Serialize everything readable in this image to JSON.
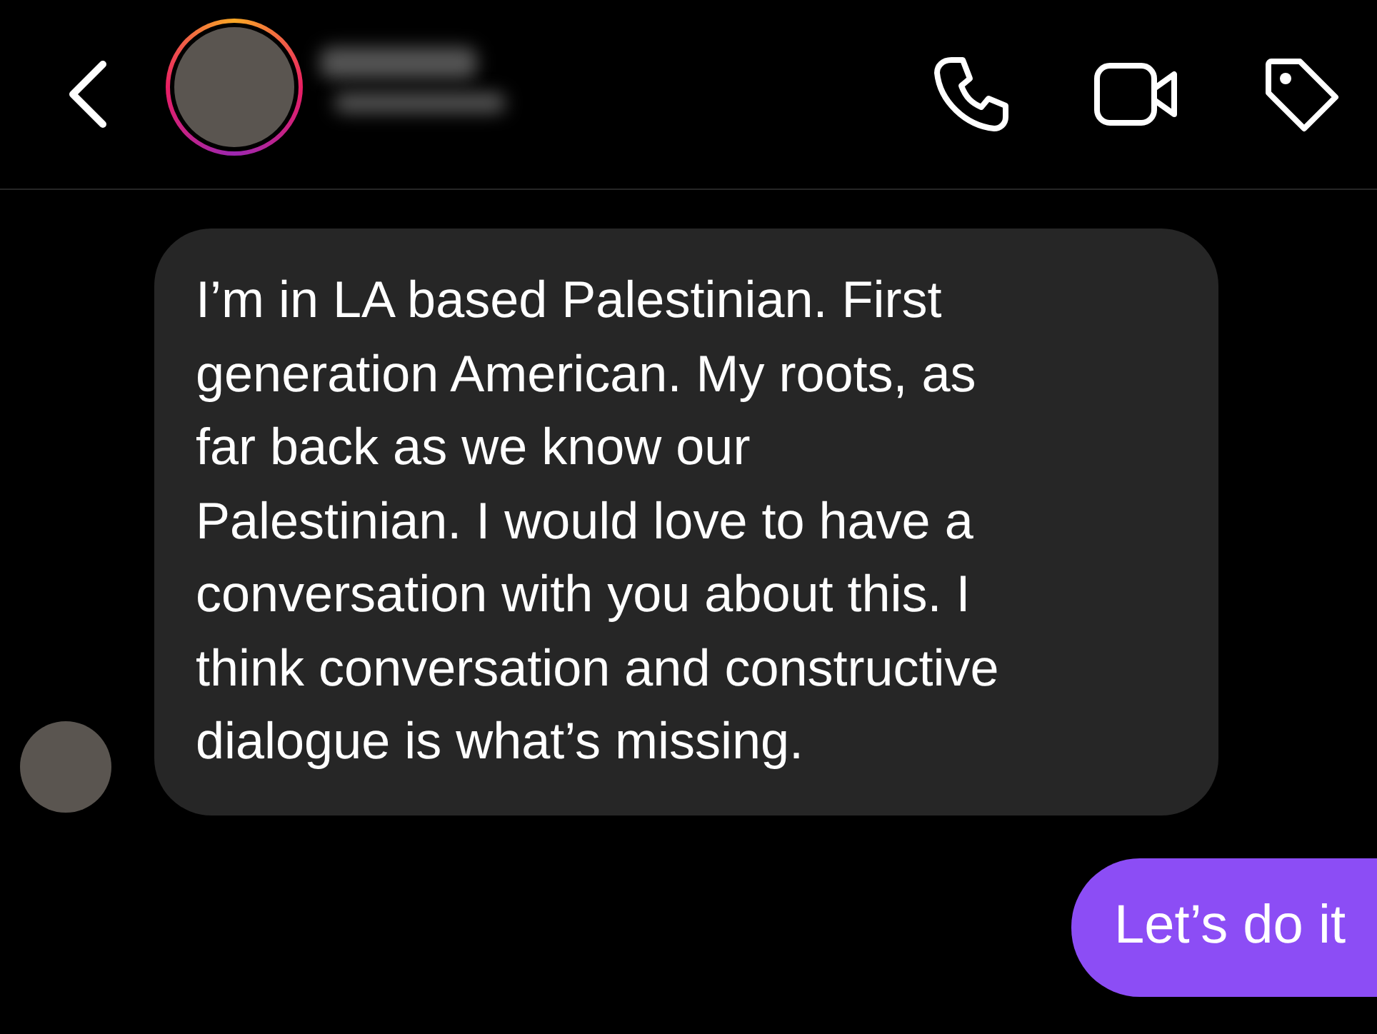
{
  "header": {
    "contact_name_blurred": true
  },
  "messages": [
    {
      "kind": "incoming",
      "lines": [
        "I’m in LA based Palestinian. First",
        "generation American. My roots, as",
        "far back as we know our",
        "Palestinian. I would love to have a",
        "conversation with you about this. I",
        "think conversation and constructive",
        "dialogue is what’s missing."
      ]
    },
    {
      "kind": "outgoing",
      "lines": [
        "Let’s do it"
      ]
    }
  ]
}
